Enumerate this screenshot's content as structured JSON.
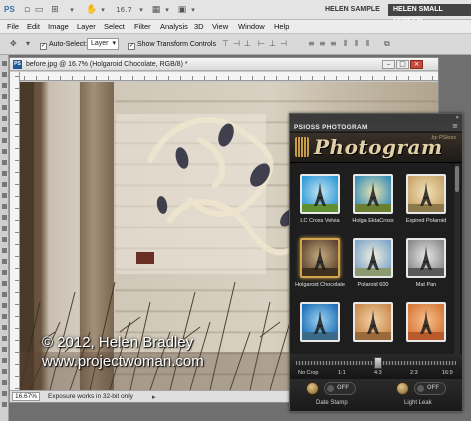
{
  "app": {
    "logo": "PS",
    "zoom_value": "16.7",
    "workspaces": [
      "HELEN SAMPLE",
      "HELEN SMALL SCREEN"
    ]
  },
  "menu": [
    "File",
    "Edit",
    "Image",
    "Layer",
    "Select",
    "Filter",
    "Analysis",
    "3D",
    "View",
    "Window",
    "Help"
  ],
  "options": {
    "auto_select_label": "Auto-Select:",
    "auto_select_value": "Layer",
    "show_transform_label": "Show Transform Controls"
  },
  "document": {
    "title": "before.jpg @ 16.7% (Holgaroid Chocolate, RGB/8) *",
    "zoom": "16.67%",
    "status": "Exposure works in 32-bit only",
    "watermark_line1": "© 2012, Helen Bradley",
    "watermark_line2": "www.projectwoman.com"
  },
  "plugin": {
    "tab_close": "»",
    "panel_title": "PSIOSS PHOTOGRAM",
    "menu_icon": "≡",
    "logo": "Photogram",
    "by": "by PSioss",
    "presets": [
      {
        "label": "LC Cross Velvia",
        "colors": [
          "#2f9ad8",
          "#c3e4f2",
          "#5f8f2e"
        ]
      },
      {
        "label": "Holga EktaCross",
        "colors": [
          "#3a8fb8",
          "#e8e2b0",
          "#6a7f32"
        ]
      },
      {
        "label": "Expired Polaroid",
        "colors": [
          "#c9a46a",
          "#f1e2b8",
          "#8d7a4b"
        ]
      },
      {
        "label": "Holgaroid Chocolate",
        "colors": [
          "#5c4630",
          "#c9ad82",
          "#3e3020"
        ]
      },
      {
        "label": "Polaroid 600",
        "colors": [
          "#7fa6c9",
          "#f1efe0",
          "#8b9a70"
        ]
      },
      {
        "label": "Mat Pan",
        "colors": [
          "#8a8a8a",
          "#e8e8e8",
          "#5a5a5a"
        ]
      },
      {
        "label": "",
        "colors": [
          "#1e6fb8",
          "#9dd3ef",
          "#3a6a8a"
        ]
      },
      {
        "label": "",
        "colors": [
          "#c98a4e",
          "#f3d3a5",
          "#9a6a3a"
        ]
      },
      {
        "label": "",
        "colors": [
          "#d6783a",
          "#f7c08a",
          "#b85a2a"
        ]
      }
    ],
    "selected_preset": 3,
    "crop_labels": [
      "No Crop",
      "1:1",
      "4:3",
      "2:3",
      "16:9"
    ],
    "crop_value": "4:3",
    "date_stamp": {
      "label": "Date Stamp",
      "state": "OFF"
    },
    "light_leak": {
      "label": "Light Leak",
      "state": "OFF"
    }
  },
  "corner_mark": "www.w..com"
}
